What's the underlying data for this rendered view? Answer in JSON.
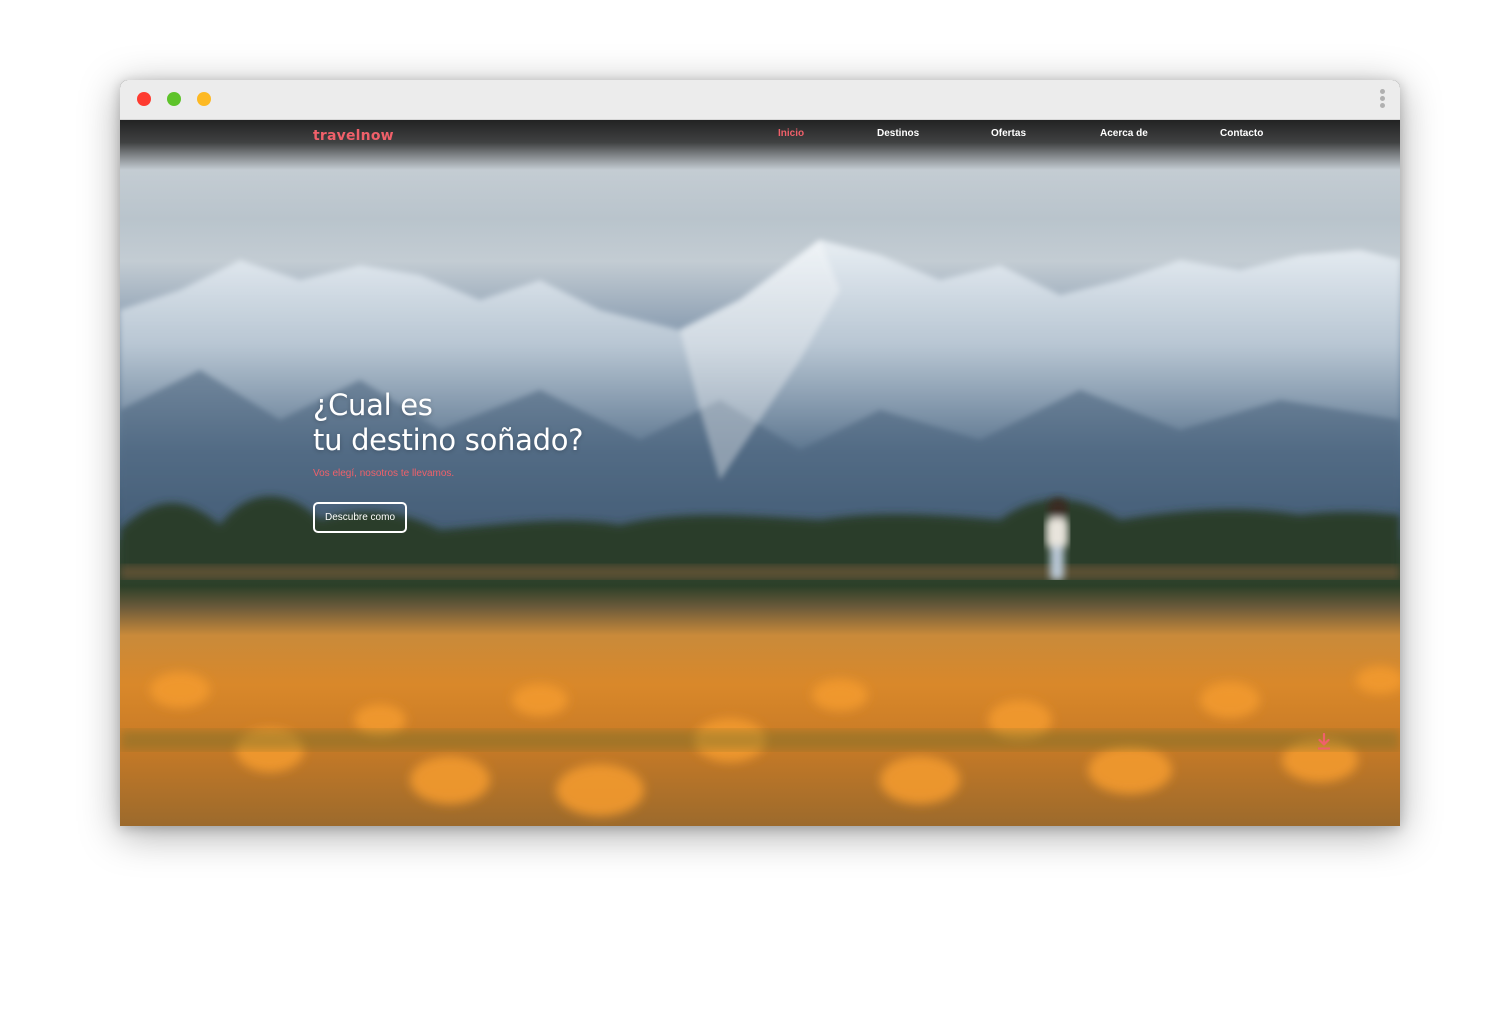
{
  "window": {
    "controls": [
      "close",
      "minimize",
      "zoom"
    ],
    "menu_icon": "kebab-menu-icon"
  },
  "site": {
    "brand": "travelnow",
    "nav": [
      {
        "label": "Inicio",
        "active": true
      },
      {
        "label": "Destinos",
        "active": false
      },
      {
        "label": "Ofertas",
        "active": false
      },
      {
        "label": "Acerca de",
        "active": false
      },
      {
        "label": "Contacto",
        "active": false
      }
    ],
    "hero": {
      "title": "¿Cual es\ntu destino soñado?",
      "subtitle": "Vos elegí, nosotros te llevamos.",
      "cta_label": "Descubre como",
      "scroll_icon": "download-arrow-icon"
    }
  },
  "colors": {
    "accent": "#f0606a",
    "titlebar": "#ececec",
    "close": "#fe3b30",
    "minimize": "#5ec32a",
    "zoom": "#fdb923"
  }
}
